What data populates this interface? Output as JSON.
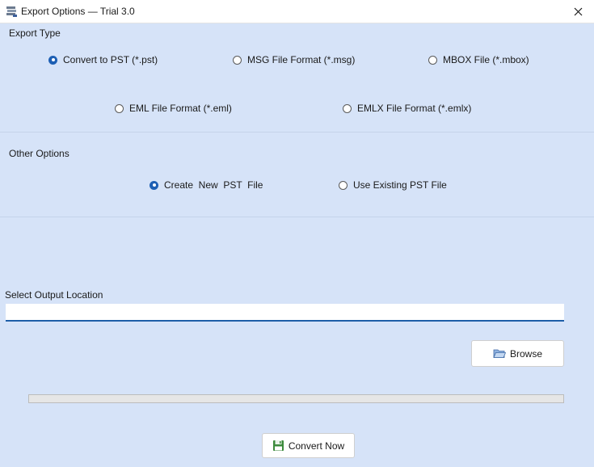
{
  "window": {
    "title": "Export Options — Trial 3.0",
    "close_icon": "close-icon",
    "app_icon": "stacked-folders-icon"
  },
  "export_type": {
    "label": "Export Type",
    "options": [
      {
        "label": "Convert to PST (*.pst)",
        "checked": true
      },
      {
        "label": "MSG File Format (*.msg)",
        "checked": false
      },
      {
        "label": "MBOX File (*.mbox)",
        "checked": false
      },
      {
        "label": "EML File Format (*.eml)",
        "checked": false
      },
      {
        "label": "EMLX File Format (*.emlx)",
        "checked": false
      }
    ]
  },
  "other_options": {
    "label": "Other Options",
    "options": [
      {
        "label": "Create  New  PST  File",
        "checked": true
      },
      {
        "label": "Use Existing PST File",
        "checked": false
      }
    ]
  },
  "output": {
    "label": "Select Output Location",
    "value": "",
    "placeholder": ""
  },
  "browse": {
    "label": "Browse",
    "icon": "folder-open-icon"
  },
  "progress": {
    "value": 0
  },
  "convert": {
    "label": "Convert Now",
    "icon": "save-icon"
  },
  "colors": {
    "background": "#d6e3f8",
    "accent": "#1d5fb4"
  }
}
